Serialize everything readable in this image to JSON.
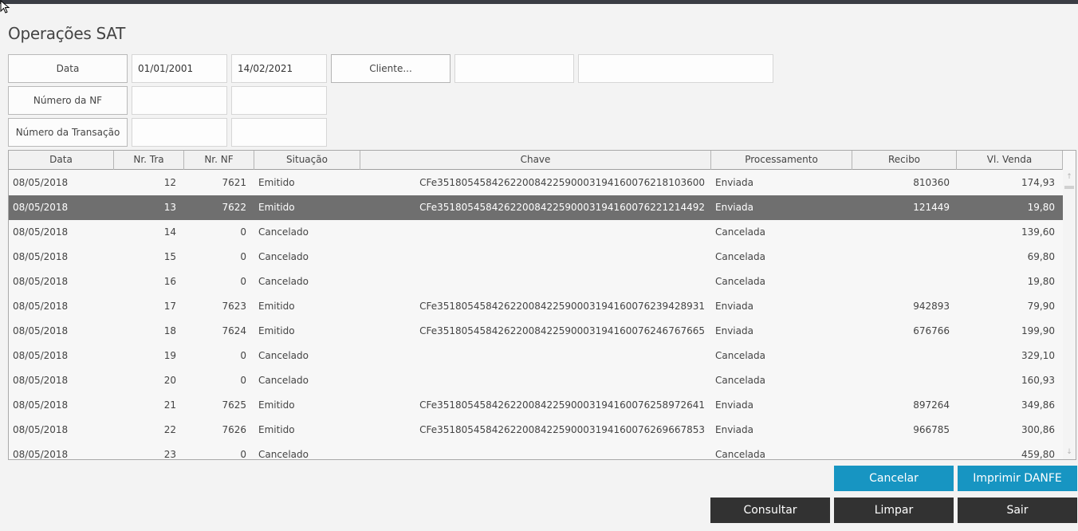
{
  "header": {
    "title": "Operações SAT"
  },
  "filters": {
    "data_label": "Data",
    "date_from": "01/01/2001",
    "date_to": "14/02/2021",
    "cliente_button": "Cliente...",
    "cliente_code": "",
    "cliente_name": "",
    "nf_label": "Número da NF",
    "nf_from": "",
    "nf_to": "",
    "transacao_label": "Número da Transação",
    "transacao_from": "",
    "transacao_to": ""
  },
  "grid": {
    "columns": [
      "Data",
      "Nr. Tra",
      "Nr. NF",
      "Situação",
      "Chave",
      "Processamento",
      "Recibo",
      "Vl. Venda"
    ],
    "selected_row": 1,
    "rows": [
      [
        "08/05/2018",
        "12",
        "7621",
        "Emitido",
        "CFe35180545842622008422590003194160076218103600",
        "Enviada",
        "810360",
        "174,93"
      ],
      [
        "08/05/2018",
        "13",
        "7622",
        "Emitido",
        "CFe35180545842622008422590003194160076221214492",
        "Enviada",
        "121449",
        "19,80"
      ],
      [
        "08/05/2018",
        "14",
        "0",
        "Cancelado",
        "",
        "Cancelada",
        "",
        "139,60"
      ],
      [
        "08/05/2018",
        "15",
        "0",
        "Cancelado",
        "",
        "Cancelada",
        "",
        "69,80"
      ],
      [
        "08/05/2018",
        "16",
        "0",
        "Cancelado",
        "",
        "Cancelada",
        "",
        "19,80"
      ],
      [
        "08/05/2018",
        "17",
        "7623",
        "Emitido",
        "CFe35180545842622008422590003194160076239428931",
        "Enviada",
        "942893",
        "79,90"
      ],
      [
        "08/05/2018",
        "18",
        "7624",
        "Emitido",
        "CFe35180545842622008422590003194160076246767665",
        "Enviada",
        "676766",
        "199,90"
      ],
      [
        "08/05/2018",
        "19",
        "0",
        "Cancelado",
        "",
        "Cancelada",
        "",
        "329,10"
      ],
      [
        "08/05/2018",
        "20",
        "0",
        "Cancelado",
        "",
        "Cancelada",
        "",
        "160,93"
      ],
      [
        "08/05/2018",
        "21",
        "7625",
        "Emitido",
        "CFe35180545842622008422590003194160076258972641",
        "Enviada",
        "897264",
        "349,86"
      ],
      [
        "08/05/2018",
        "22",
        "7626",
        "Emitido",
        "CFe35180545842622008422590003194160076269667853",
        "Enviada",
        "966785",
        "300,86"
      ],
      [
        "08/05/2018",
        "23",
        "0",
        "Cancelado",
        "",
        "Cancelada",
        "",
        "459,80"
      ]
    ]
  },
  "buttons": {
    "cancelar": "Cancelar",
    "imprimir_danfe": "Imprimir DANFE",
    "consultar": "Consultar",
    "limpar": "Limpar",
    "sair": "Sair"
  },
  "colors": {
    "blue_button": "#1795c2",
    "dark_button": "#323232",
    "selected_row": "#6f6f6f"
  },
  "icons": {
    "scroll_up": "arrow-up-icon",
    "scroll_down": "arrow-down-icon",
    "cursor": "mouse-pointer-icon"
  }
}
